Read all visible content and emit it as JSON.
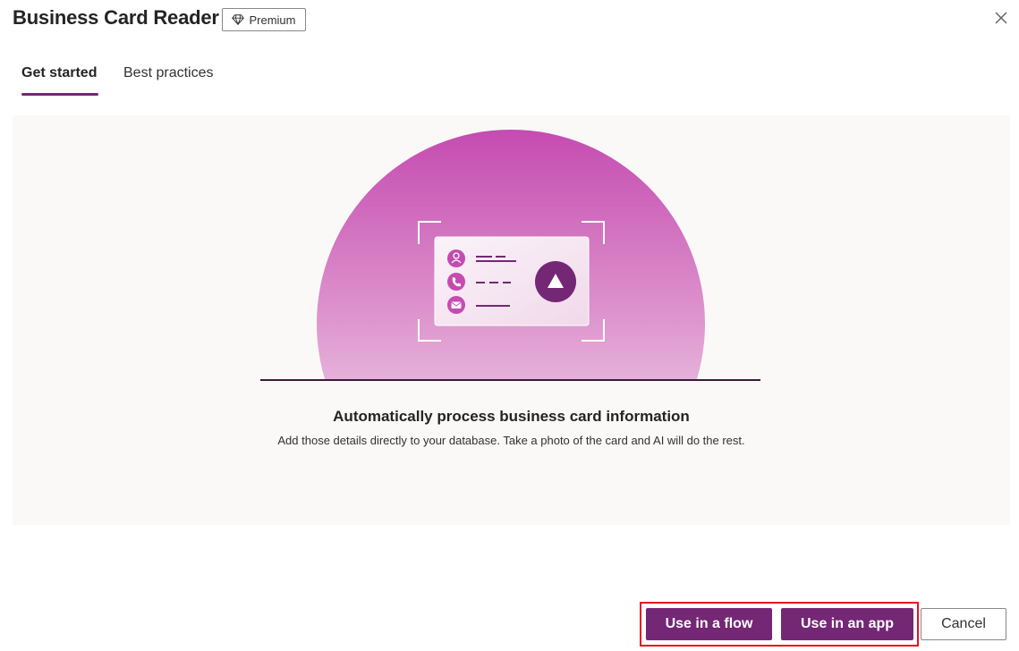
{
  "dialog": {
    "title": "Business Card Reader",
    "badge_label": "Premium",
    "badge_icon": "diamond-icon",
    "close_icon": "close-icon"
  },
  "tabs": [
    {
      "label": "Get started",
      "active": true
    },
    {
      "label": "Best practices",
      "active": false
    }
  ],
  "hero": {
    "heading": "Automatically process business card information",
    "description": "Add those details directly to your database. Take a photo of the card and AI will do the rest.",
    "illustration_icons": [
      "person-icon",
      "phone-icon",
      "mail-icon",
      "upload-icon"
    ]
  },
  "footer": {
    "use_in_flow": "Use in a flow",
    "use_in_app": "Use in an app",
    "cancel": "Cancel"
  },
  "colors": {
    "accent": "#742774",
    "highlight": "#e81123",
    "hero_bg": "#faf9f8",
    "circle_top": "#c54bb1"
  }
}
